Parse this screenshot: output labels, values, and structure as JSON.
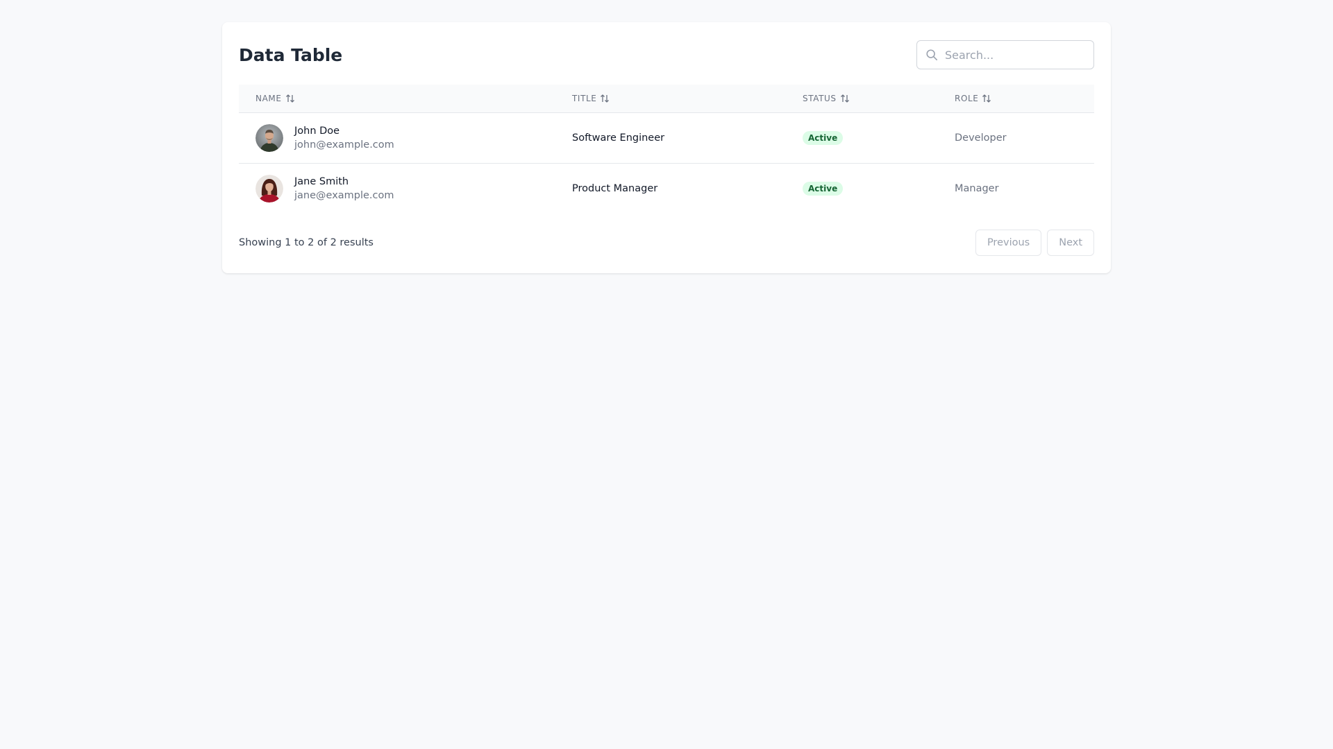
{
  "page": {
    "title": "Data Table"
  },
  "search": {
    "placeholder": "Search...",
    "value": "",
    "icon": "search-icon"
  },
  "table": {
    "columns": [
      {
        "label": "NAME",
        "sort_icon": "sort-arrows-icon"
      },
      {
        "label": "TITLE",
        "sort_icon": "sort-arrows-icon"
      },
      {
        "label": "STATUS",
        "sort_icon": "sort-arrows-icon"
      },
      {
        "label": "ROLE",
        "sort_icon": "sort-arrows-icon"
      }
    ],
    "rows": [
      {
        "name": "John Doe",
        "email": "john@example.com",
        "title": "Software Engineer",
        "status": "Active",
        "role": "Developer",
        "avatar": "avatar-photo-man"
      },
      {
        "name": "Jane Smith",
        "email": "jane@example.com",
        "title": "Product Manager",
        "status": "Active",
        "role": "Manager",
        "avatar": "avatar-photo-woman"
      }
    ]
  },
  "footer": {
    "results_text": "Showing 1 to 2 of 2 results",
    "previous_label": "Previous",
    "next_label": "Next"
  },
  "colors": {
    "background": "#f8f9fb",
    "status_active_bg": "#dcfce7",
    "status_active_text": "#166534"
  }
}
